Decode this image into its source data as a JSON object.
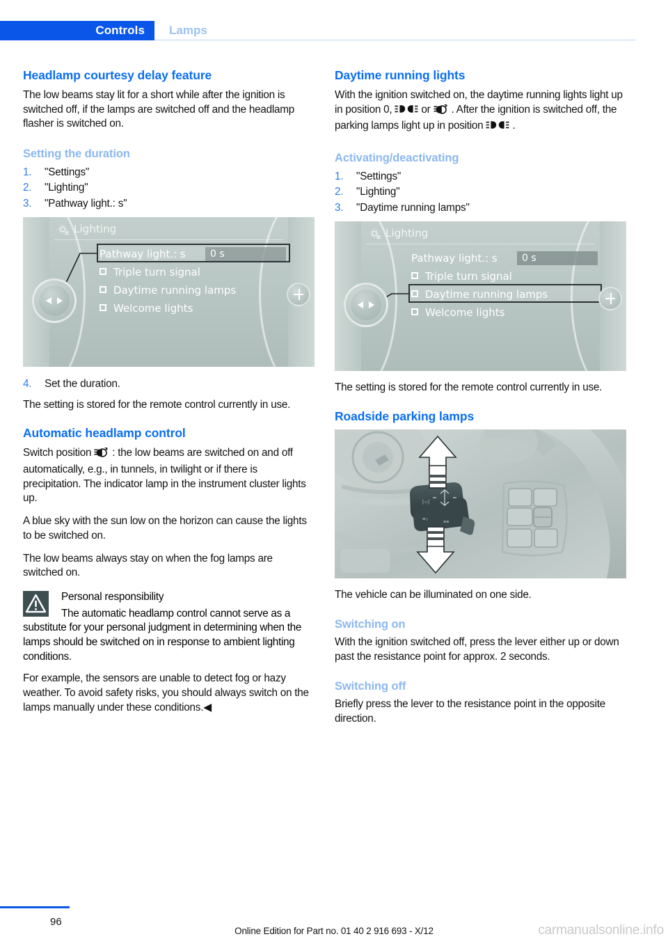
{
  "header": {
    "tab_label": "Controls",
    "section_label": "Lamps"
  },
  "left_column": {
    "h1": "Headlamp courtesy delay feature",
    "intro": "The low beams stay lit for a short while after the ignition is switched off, if the lamps are switched off and the headlamp flasher is switched on.",
    "sub1": "Setting the duration",
    "steps": [
      {
        "num": "1.",
        "text": "\"Settings\""
      },
      {
        "num": "2.",
        "text": "\"Lighting\""
      },
      {
        "num": "3.",
        "text": "\"Pathway light.: s\""
      }
    ],
    "step4": {
      "num": "4.",
      "text": "Set the duration."
    },
    "stored_note": "The setting is stored for the remote control currently in use.",
    "h1b": "Automatic headlamp control",
    "auto_para_before": "Switch position",
    "auto_para_after": ": the low beams are switched on and off automatically, e.g., in tunnels, in twilight or if there is precipitation. The indicator lamp in the instrument cluster lights up.",
    "blue_sky": "A blue sky with the sun low on the horizon can cause the lights to be switched on.",
    "fog_note": "The low beams always stay on when the fog lamps are switched on.",
    "warning": {
      "title": "Personal responsibility",
      "body": "The automatic headlamp control cannot serve as a substitute for your personal judgment in determining when the lamps should be switched on in response to ambient lighting conditions.",
      "tail": "For example, the sensors are unable to detect fog or hazy weather. To avoid safety risks, you should always switch on the lamps manually under these conditions.◀"
    }
  },
  "right_column": {
    "h1": "Daytime running lights",
    "drl_part1": "With the ignition switched on, the daytime running lights light up in position 0,",
    "drl_part2": "or",
    "drl_part3": ". After the ignition is switched off, the parking lamps light up in position",
    "drl_part4": ".",
    "sub1": "Activating/deactivating",
    "steps": [
      {
        "num": "1.",
        "text": "\"Settings\""
      },
      {
        "num": "2.",
        "text": "\"Lighting\""
      },
      {
        "num": "3.",
        "text": "\"Daytime running lamps\""
      }
    ],
    "stored_note": "The setting is stored for the remote control currently in use.",
    "h1b": "Roadside parking lamps",
    "illuminated_note": "The vehicle can be illuminated on one side.",
    "sub2": "Switching on",
    "switch_on_body": "With the ignition switched off, press the lever either up or down past the resistance point for approx. 2 seconds.",
    "sub3": "Switching off",
    "switch_off_body": "Briefly press the lever to the resistance point in the opposite direction."
  },
  "idrive_left": {
    "title": "Lighting",
    "rows": [
      {
        "label": "Pathway light.: s",
        "value": "0 s",
        "checkbox": false,
        "selected": true
      },
      {
        "label": "Triple turn signal",
        "checkbox": true,
        "selected": false
      },
      {
        "label": "Daytime running lamps",
        "checkbox": true,
        "selected": false
      },
      {
        "label": "Welcome lights",
        "checkbox": true,
        "selected": false
      }
    ]
  },
  "idrive_right": {
    "title": "Lighting",
    "rows": [
      {
        "label": "Pathway light.: s",
        "value": "0 s",
        "checkbox": false,
        "selected": false
      },
      {
        "label": "Triple turn signal",
        "checkbox": true,
        "selected": false
      },
      {
        "label": "Daytime running lamps",
        "checkbox": true,
        "selected": true
      },
      {
        "label": "Welcome lights",
        "checkbox": true,
        "selected": false
      }
    ]
  },
  "footer": {
    "page_number": "96",
    "edition_note": "Online Edition for Part no. 01 40 2 916 693 - X/12",
    "watermark": "carmanualsonline.info"
  },
  "colors": {
    "accent_blue": "#0a56e8",
    "heading_blue": "#0a6ef0",
    "subheading_blue": "#8bb8ef",
    "warning_box": "#3e4f52",
    "watermark_gray": "#c9c9c9"
  },
  "icons": {
    "parking_lamp": "parking-lamp-icon",
    "auto_headlamp": "auto-headlamp-icon",
    "warning": "warning-triangle-icon",
    "settings_gear": "gear-icon"
  }
}
